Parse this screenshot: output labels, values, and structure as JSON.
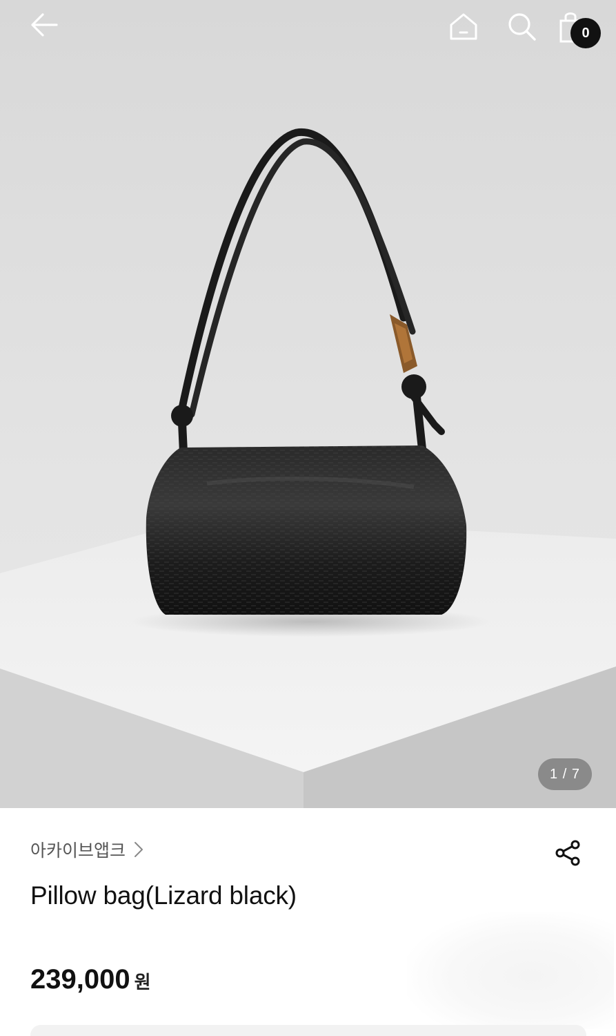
{
  "topbar": {
    "back_icon": "arrow-left-icon",
    "home_icon": "home-icon",
    "search_icon": "search-icon",
    "cart_icon": "shopping-bag-icon",
    "cart_count": "0"
  },
  "gallery": {
    "image_subject": "black lizard-texture shoulder bag on white pedestal",
    "page_indicator": "1 / 7",
    "current_index": 1,
    "total": 7
  },
  "product": {
    "brand": "아카이브앱크",
    "brand_chevron_icon": "chevron-right-icon",
    "share_icon": "share-icon",
    "name": "Pillow bag(Lizard black)",
    "price": "239,000",
    "currency": "원"
  },
  "colors": {
    "badge_bg": "#111111",
    "text_primary": "#111111",
    "text_secondary": "#555555"
  }
}
